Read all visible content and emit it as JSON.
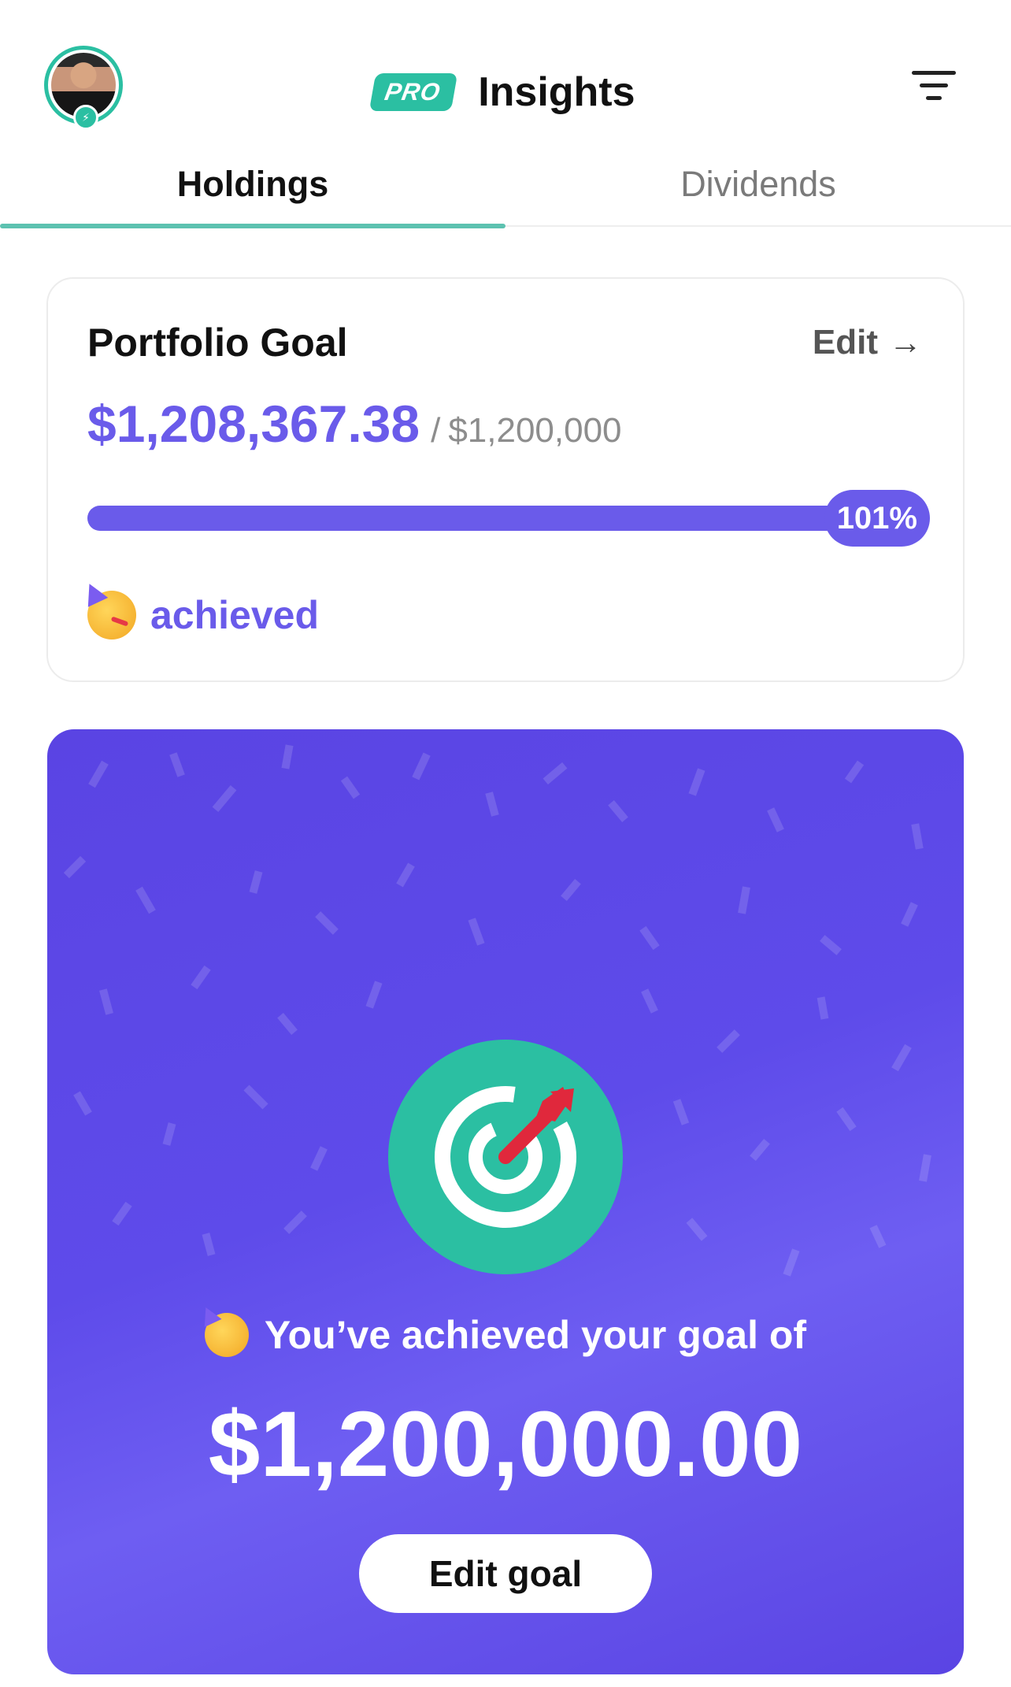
{
  "header": {
    "pro_badge": "PRO",
    "title": "Insights",
    "avatar_icon": "user-avatar",
    "avatar_badge_icon": "lightning-icon",
    "filter_icon": "filter-icon"
  },
  "tabs": [
    {
      "label": "Holdings",
      "active": true
    },
    {
      "label": "Dividends",
      "active": false
    }
  ],
  "goal_card": {
    "title": "Portfolio Goal",
    "edit_label": "Edit",
    "edit_icon": "arrow-right-icon",
    "current_value": "$1,208,367.38",
    "separator": "/",
    "target_value": "$1,200,000",
    "progress_percent": 101,
    "progress_label": "101%",
    "status_icon": "partying-face-icon",
    "status_label": "achieved"
  },
  "celebration": {
    "icon": "target-dart-icon",
    "message_icon": "partying-face-icon",
    "message": "You’ve achieved your goal of",
    "goal_amount": "$1,200,000.00",
    "button_label": "Edit goal"
  },
  "colors": {
    "accent_teal": "#2bbfa2",
    "accent_purple": "#6a5bea",
    "celebration_bg": "#5a44e3",
    "dart_red": "#e0283c"
  }
}
